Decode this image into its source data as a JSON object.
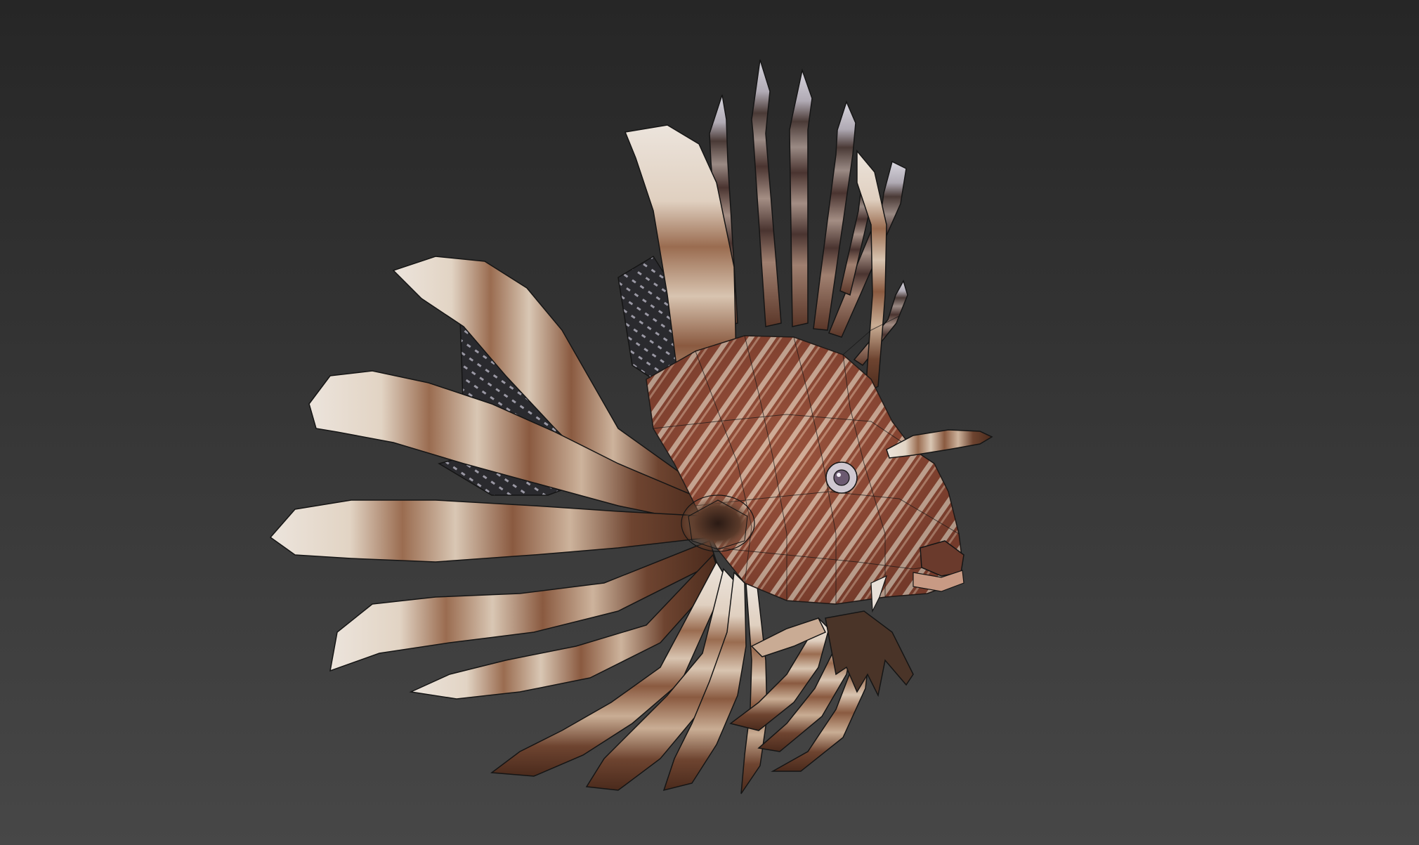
{
  "viewport": {
    "background_top": "#262626",
    "background_bottom": "#474747"
  },
  "model": {
    "subject": "lionfish-3d-model",
    "display_mode": "shaded-with-wireframe",
    "colors": {
      "fin_light": "#e9e0d6",
      "fin_mid": "#b08a6e",
      "fin_dark": "#5e3a28",
      "body_red": "#8a4a34",
      "body_stripe": "#e8d8c8",
      "spine_dark": "#4a3a36",
      "spine_tip": "#c8c4cc",
      "wire": "#151515",
      "dorsal_web": "#2a2a2e",
      "eye": "#6b5a70"
    }
  }
}
